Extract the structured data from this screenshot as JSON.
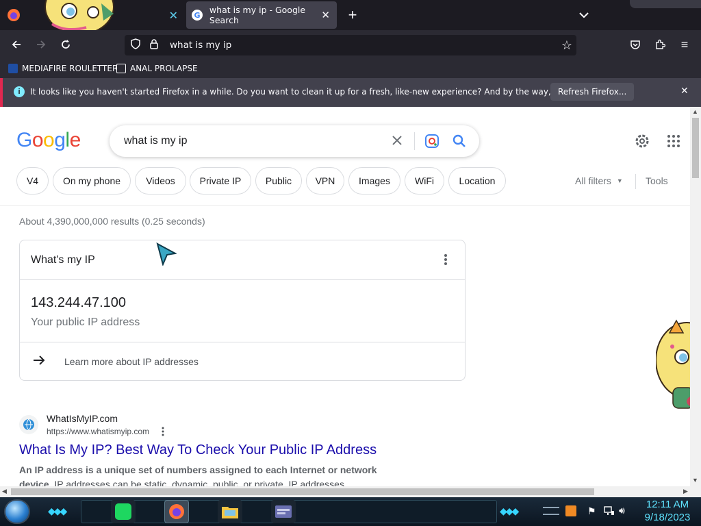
{
  "browser": {
    "tabs": [
      {
        "label": ""
      },
      {
        "label": "what is my ip - Google Search"
      }
    ],
    "url": "what is my ip",
    "bookmarks": [
      {
        "label": "MEDIAFIRE ROULETTER"
      },
      {
        "label": "ANAL PROLAPSE"
      }
    ],
    "notification": {
      "message": "It looks like you haven't started Firefox in a while. Do you want to clean it up for a fresh, like-new experience? And by the way, welcome back!",
      "button": "Refresh Firefox..."
    }
  },
  "google": {
    "query": "what is my ip",
    "chips": [
      "V4",
      "On my phone",
      "Videos",
      "Private IP",
      "Public",
      "VPN",
      "Images",
      "WiFi",
      "Location"
    ],
    "all_filters": "All filters",
    "tools": "Tools",
    "result_stats": "About 4,390,000,000 results (0.25 seconds)",
    "ip_card": {
      "title": "What's my IP",
      "ip": "143.244.47.100",
      "subtitle": "Your public IP address",
      "learn_more": "Learn more about IP addresses"
    },
    "result1": {
      "site": "WhatIsMyIP.com",
      "url": "https://www.whatismyip.com",
      "title": "What Is My IP? Best Way To Check Your Public IP Address",
      "snippet_bold": "An IP address is a unique set of numbers assigned to each Internet or network device",
      "snippet_rest": ". IP addresses can be static, dynamic, public, or private. IP addresses ..."
    }
  },
  "taskbar": {
    "time": "12:11 AM",
    "date": "9/18/2023"
  },
  "colors": {
    "link": "#1a0dab",
    "google_blue": "#4285f4",
    "google_red": "#ea4335",
    "google_yellow": "#fbbc05",
    "google_green": "#34a853",
    "firefox_dark": "#1c1b22",
    "notice_accent": "#e22850"
  }
}
